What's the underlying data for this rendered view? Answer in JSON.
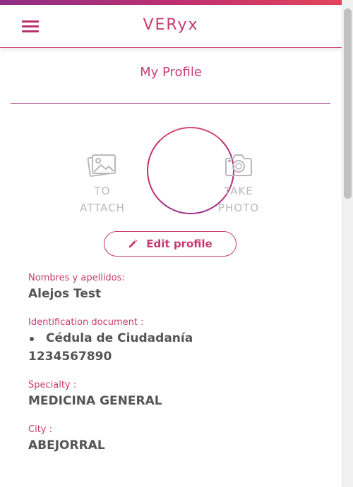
{
  "header": {
    "app_title": "VERyx",
    "menu_icon": "hamburger-menu-icon"
  },
  "page": {
    "title": "My Profile"
  },
  "avatar_actions": {
    "attach": {
      "line1": "TO",
      "line2": "ATTACH",
      "icon": "image-gallery-icon"
    },
    "photo": {
      "line1": "TAKE",
      "line2": "PHOTO",
      "icon": "camera-icon"
    }
  },
  "edit_button": {
    "label": "Edit profile",
    "icon": "pencil-icon"
  },
  "profile": {
    "name_label": "Nombres y apellidos:",
    "name_value": "Alejos Test",
    "id_label": "Identification document :",
    "id_type": "Cédula de Ciudadanía",
    "id_number": "1234567890",
    "specialty_label": "Specialty :",
    "specialty_value": "MEDICINA GENERAL",
    "city_label": "City :",
    "city_value": "ABEJORRAL"
  },
  "colors": {
    "accent": "#c73a6c",
    "gradient_start": "#8e2f86",
    "gradient_end": "#e3465a",
    "muted": "#b9b9b9",
    "text": "#555555"
  }
}
